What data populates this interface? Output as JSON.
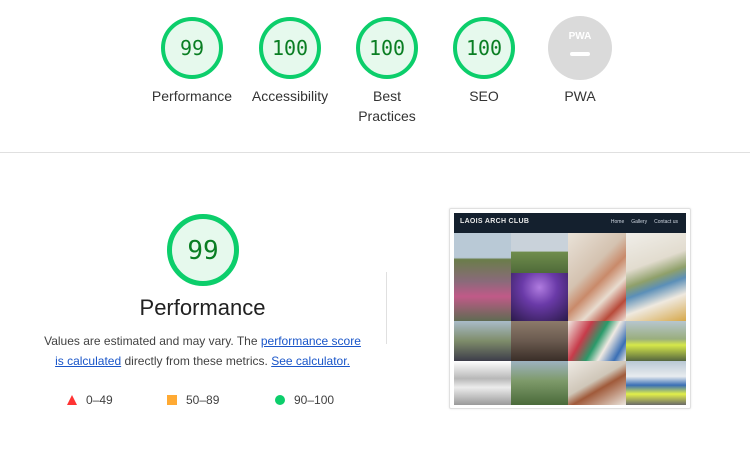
{
  "gauges": [
    {
      "score": "99",
      "label": "Performance",
      "color": "#0cce6b"
    },
    {
      "score": "100",
      "label": "Accessibility",
      "color": "#0cce6b"
    },
    {
      "score": "100",
      "label_line1": "Best",
      "label_line2": "Practices",
      "color": "#0cce6b"
    },
    {
      "score": "100",
      "label": "SEO",
      "color": "#0cce6b"
    },
    {
      "badge": "PWA",
      "label": "PWA",
      "color": "#cccccc"
    }
  ],
  "performance": {
    "score": "99",
    "title": "Performance",
    "desc_before": "Values are estimated and may vary. The ",
    "desc_link1": "performance score is calculated",
    "desc_middle": " directly from these metrics. ",
    "desc_link2": "See calculator."
  },
  "legend": {
    "fail": "0–49",
    "average": "50–89",
    "pass": "90–100"
  },
  "thumbnail": {
    "brand": "LAOIS ARCH CLUB",
    "menu": [
      "Home",
      "Gallery",
      "Contact us"
    ]
  },
  "colors": {
    "pass": "#0cce6b",
    "pass_text": "#0a7e23",
    "average": "#ffaa33",
    "fail": "#ff3333",
    "link": "#1a56c9"
  }
}
